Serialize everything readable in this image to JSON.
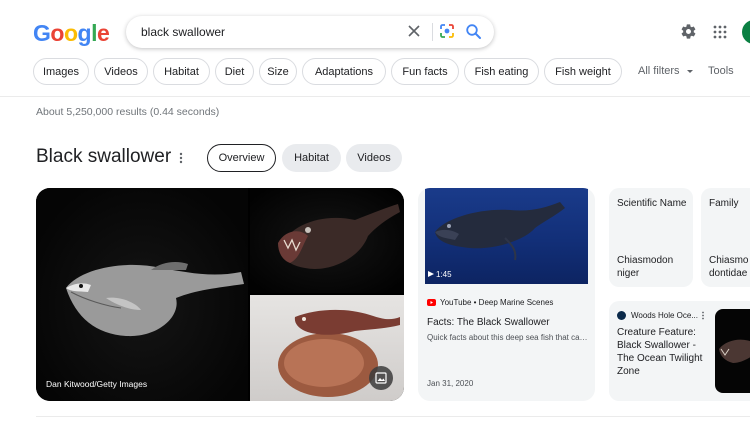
{
  "logo": {
    "letters": [
      "G",
      "o",
      "o",
      "g",
      "l",
      "e"
    ],
    "colors": [
      "#4285f4",
      "#ea4335",
      "#fbbc05",
      "#4285f4",
      "#34a853",
      "#ea4335"
    ]
  },
  "search": {
    "query": "black swallower"
  },
  "chips": [
    {
      "label": "Images"
    },
    {
      "label": "Videos"
    },
    {
      "label": "Habitat"
    },
    {
      "label": "Diet"
    },
    {
      "label": "Size"
    },
    {
      "label": "Adaptations"
    },
    {
      "label": "Fun facts"
    },
    {
      "label": "Fish eating"
    },
    {
      "label": "Fish weight"
    }
  ],
  "filters": {
    "all_filters": "All filters",
    "tools": "Tools"
  },
  "results": {
    "count_text": "About 5,250,000 results (0.44 seconds)"
  },
  "knowledge_panel": {
    "title": "Black swallower",
    "tabs": [
      {
        "label": "Overview",
        "active": true
      },
      {
        "label": "Habitat",
        "active": false
      },
      {
        "label": "Videos",
        "active": false
      }
    ]
  },
  "images": {
    "credit": "Dan Kitwood/Getty Images"
  },
  "video": {
    "duration": "1:45",
    "source": "YouTube • Deep Marine Scenes",
    "title": "Facts: The Black Swallower",
    "description": "Quick facts about this deep sea fish that can swallow prey larger than itself",
    "date": "Jan 31, 2020"
  },
  "facts": [
    {
      "label": "Scientific Name",
      "value": "Chiasmodon niger"
    },
    {
      "label": "Family",
      "value": "Chiasmodontidae"
    }
  ],
  "article": {
    "source": "Woods Hole Oce...",
    "title": "Creature Feature: Black Swallower - The Ocean Twilight Zone"
  }
}
